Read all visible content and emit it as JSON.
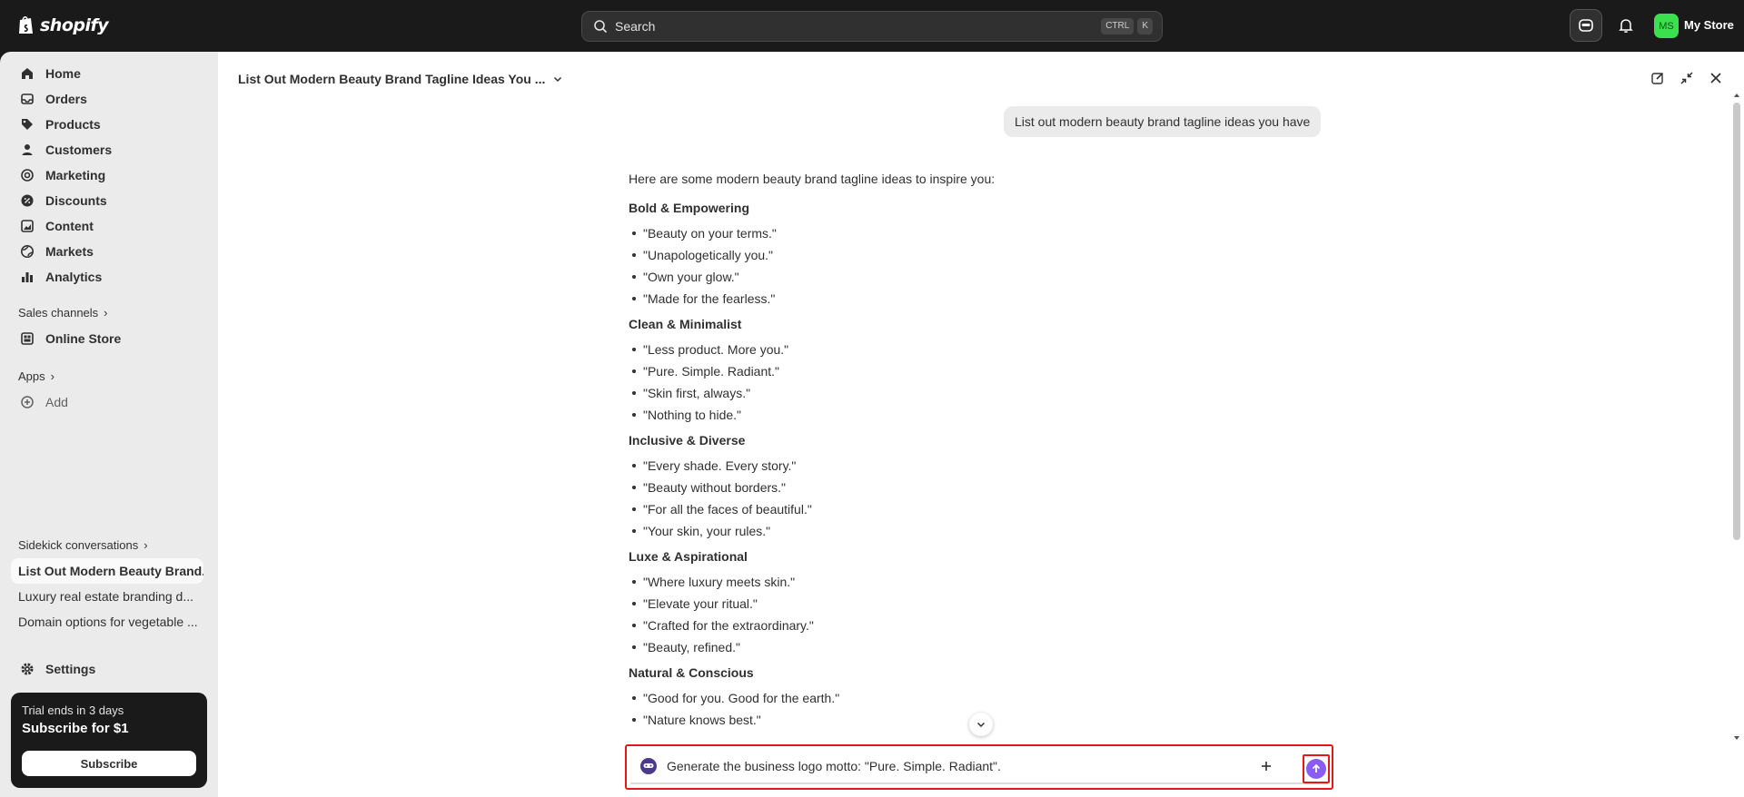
{
  "topbar": {
    "logo_text": "shopify",
    "search_placeholder": "Search",
    "shortcut_ctrl": "CTRL",
    "shortcut_k": "K",
    "avatar_initials": "MS",
    "store_name": "My Store"
  },
  "sidebar": {
    "nav": [
      {
        "label": "Home",
        "icon": "home-icon"
      },
      {
        "label": "Orders",
        "icon": "inbox-icon"
      },
      {
        "label": "Products",
        "icon": "tag-icon"
      },
      {
        "label": "Customers",
        "icon": "person-icon"
      },
      {
        "label": "Marketing",
        "icon": "target-icon"
      },
      {
        "label": "Discounts",
        "icon": "discount-icon"
      },
      {
        "label": "Content",
        "icon": "content-icon"
      },
      {
        "label": "Markets",
        "icon": "globe-icon"
      },
      {
        "label": "Analytics",
        "icon": "bar-chart-icon"
      }
    ],
    "sales_channels_label": "Sales channels",
    "online_store_label": "Online Store",
    "apps_label": "Apps",
    "add_label": "Add",
    "sidekick_label": "Sidekick conversations",
    "conversations": [
      "List Out Modern Beauty Brand...",
      "Luxury real estate branding d...",
      "Domain options for vegetable ..."
    ],
    "settings_label": "Settings",
    "trial": {
      "line1": "Trial ends in 3 days",
      "line2": "Subscribe for $1",
      "button": "Subscribe"
    }
  },
  "main": {
    "title": "List Out Modern Beauty Brand Tagline Ideas You ...",
    "user_message": "List out modern beauty brand tagline ideas you have",
    "intro": "Here are some modern beauty brand tagline ideas to inspire you:",
    "categories": [
      {
        "name": "Bold & Empowering",
        "items": [
          "\"Beauty on your terms.\"",
          "\"Unapologetically you.\"",
          "\"Own your glow.\"",
          "\"Made for the fearless.\""
        ]
      },
      {
        "name": "Clean & Minimalist",
        "items": [
          "\"Less product. More you.\"",
          "\"Pure. Simple. Radiant.\"",
          "\"Skin first, always.\"",
          "\"Nothing to hide.\""
        ]
      },
      {
        "name": "Inclusive & Diverse",
        "items": [
          "\"Every shade. Every story.\"",
          "\"Beauty without borders.\"",
          "\"For all the faces of beautiful.\"",
          "\"Your skin, your rules.\""
        ]
      },
      {
        "name": "Luxe & Aspirational",
        "items": [
          "\"Where luxury meets skin.\"",
          "\"Elevate your ritual.\"",
          "\"Crafted for the extraordinary.\"",
          "\"Beauty, refined.\""
        ]
      },
      {
        "name": "Natural & Conscious",
        "items": [
          "\"Good for you. Good for the earth.\"",
          "\"Nature knows best.\""
        ]
      }
    ],
    "composer_text": "Generate the business logo motto: \"Pure. Simple. Radiant\"."
  },
  "colors": {
    "accent_send": "#8a5cf6",
    "highlight_box": "#e01a1a",
    "avatar_bg": "#3ae04e"
  }
}
